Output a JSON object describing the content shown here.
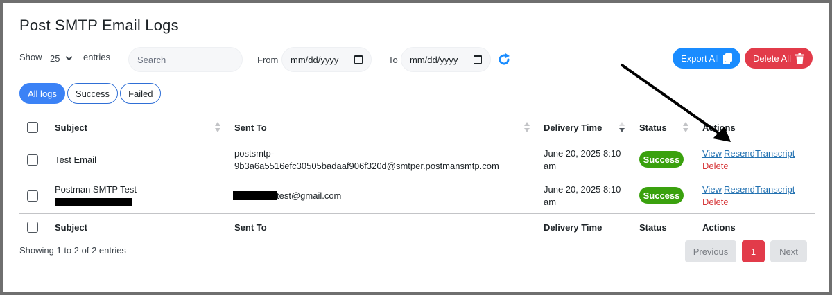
{
  "page": {
    "title": "Post SMTP Email Logs"
  },
  "toolbar": {
    "show_label": "Show",
    "page_size": "25",
    "entries_label": "entries",
    "search_placeholder": "Search",
    "from_label": "From",
    "from_placeholder": "mm/dd/yyyy",
    "to_label": "To",
    "to_placeholder": "mm/dd/yyyy",
    "export_label": "Export All",
    "delete_all_label": "Delete All"
  },
  "filters": [
    "All logs",
    "Success",
    "Failed"
  ],
  "columns": {
    "subject": "Subject",
    "sent_to": "Sent To",
    "delivery_time": "Delivery Time",
    "status": "Status",
    "actions": "Actions"
  },
  "rows": [
    {
      "subject": "Test Email",
      "sent_to_line1": "postsmtp-",
      "sent_to_line2": "9b3a6a5516efc30505badaaf906f320d@smtper.postmansmtp.com",
      "delivery_line1": "June 20, 2025 8:10",
      "delivery_line2": "am",
      "status": "Success",
      "actions": {
        "view": "View",
        "resend": "Resend",
        "transcript": "Transcript",
        "delete": "Delete"
      }
    },
    {
      "subject": "Postman SMTP Test",
      "sent_to_suffix": "test@gmail.com",
      "delivery_line1": "June 20, 2025 8:10",
      "delivery_line2": "am",
      "status": "Success",
      "actions": {
        "view": "View",
        "resend": "Resend",
        "transcript": "Transcript",
        "delete": "Delete"
      }
    }
  ],
  "footer": {
    "info": "Showing 1 to 2 of 2 entries"
  },
  "pagination": {
    "previous": "Previous",
    "current": "1",
    "next": "Next"
  },
  "colors": {
    "primary": "#1a8cff",
    "danger": "#e23b4a",
    "success": "#3aa10e",
    "link": "#2271b1",
    "pill_active": "#3b82f6"
  },
  "icons": {
    "export": "copy-icon",
    "delete_all": "trash-icon",
    "refresh": "refresh-icon",
    "calendar": "calendar-icon",
    "annotation": "arrow-annotation"
  }
}
